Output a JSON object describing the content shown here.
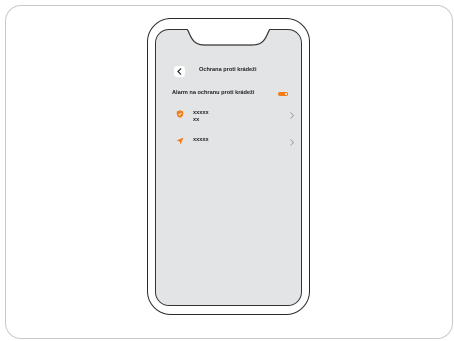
{
  "header": {
    "title": "Ochrana proti krádeži",
    "back_icon": "chevron-left-icon"
  },
  "alarm": {
    "label": "Alarm na ochranu proti krádeži",
    "enabled": true
  },
  "items": [
    {
      "icon": "shield-icon",
      "line1": "xxxxx",
      "line2": "xx"
    },
    {
      "icon": "location-arrow-icon",
      "line1": "xxxxx"
    }
  ],
  "colors": {
    "accent": "#f07d1a",
    "screen_bg": "#e2e4e6",
    "text": "#222222"
  }
}
